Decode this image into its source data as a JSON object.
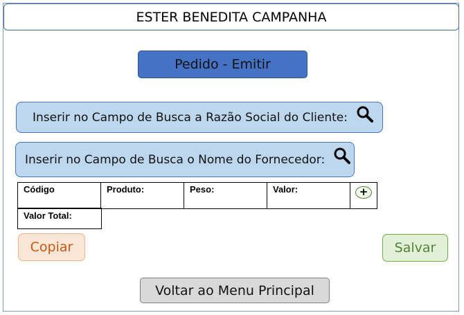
{
  "header": {
    "title": "ESTER BENEDITA CAMPANHA"
  },
  "main": {
    "primary_button": "Pedido - Emitir",
    "search_client": {
      "label": "Inserir no Campo de Busca a Razão Social do Cliente:",
      "icon": "search-icon"
    },
    "search_supplier": {
      "label": "Inserir no Campo de Busca o Nome do Fornecedor:",
      "icon": "search-icon"
    },
    "table": {
      "columns": [
        "Código",
        "Produto:",
        "Peso:",
        "Valor:"
      ],
      "add_button": "+",
      "total_label": "Valor Total:"
    }
  },
  "actions": {
    "copy_label": "Copiar",
    "save_label": "Salvar",
    "back_label": "Voltar ao Menu Principal"
  },
  "colors": {
    "primary": "#4472c4",
    "search_bg": "#bdd7ee",
    "copy_bg": "#fbe5d6",
    "copy_text": "#c55a11",
    "save_bg": "#e2f0d9",
    "save_text": "#548235",
    "back_bg": "#d9d9d9"
  }
}
